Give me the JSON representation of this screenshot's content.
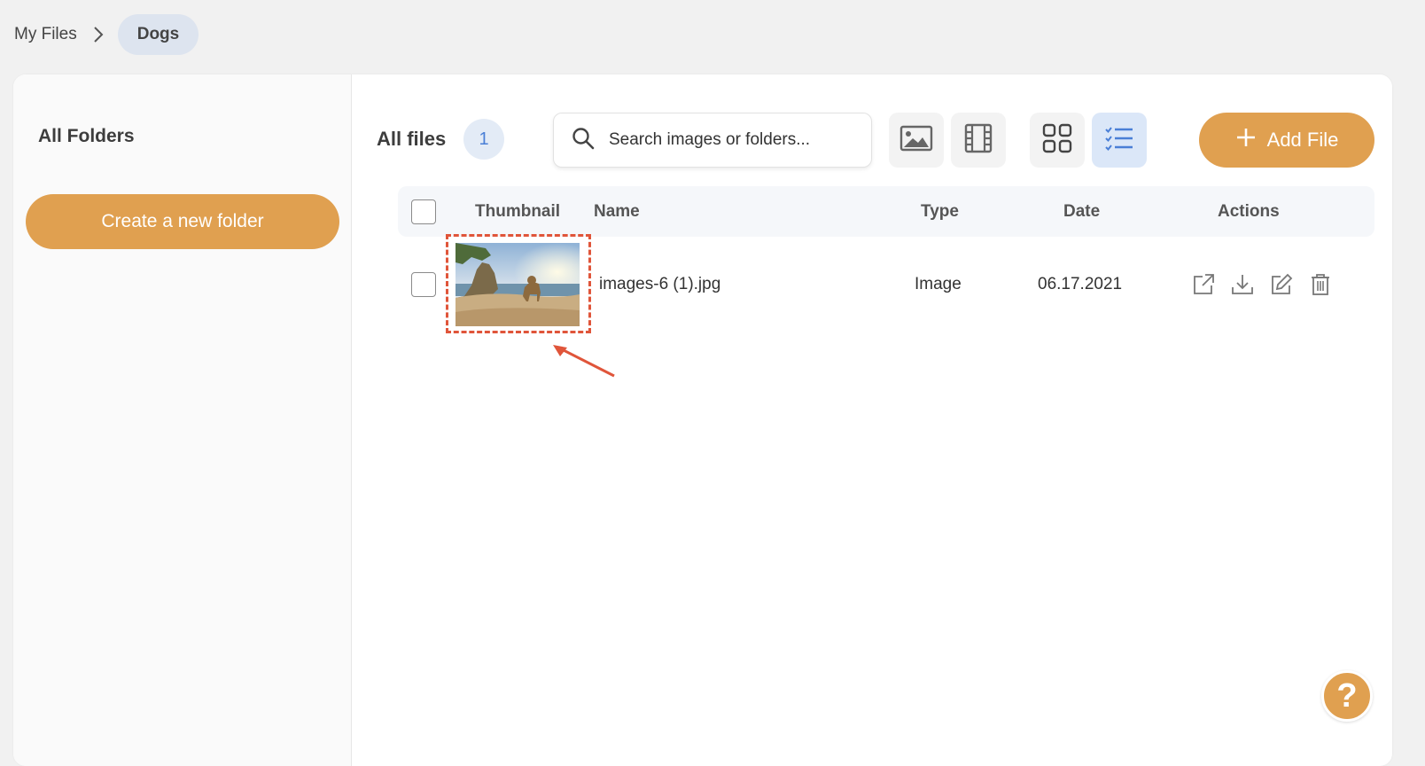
{
  "breadcrumb": {
    "root": "My Files",
    "current": "Dogs"
  },
  "sidebar": {
    "title": "All Folders",
    "new_folder_label": "Create a new folder"
  },
  "files": {
    "title": "All files",
    "count": "1"
  },
  "search": {
    "placeholder": "Search images or folders..."
  },
  "toolbar": {
    "filters": [
      "image-filter-icon",
      "video-filter-icon"
    ],
    "views": [
      "grid-view-icon",
      "list-view-icon"
    ],
    "active_view": "list",
    "add_file_label": "Add File"
  },
  "table": {
    "headers": {
      "thumbnail": "Thumbnail",
      "name": "Name",
      "type": "Type",
      "date": "Date",
      "actions": "Actions"
    },
    "rows": [
      {
        "name": "images-6 (1).jpg",
        "type": "Image",
        "date": "06.17.2021",
        "actions": [
          "share-icon",
          "download-icon",
          "edit-icon",
          "delete-icon"
        ]
      }
    ]
  },
  "help_label": "?",
  "colors": {
    "accent": "#e0a050",
    "highlight": "#e0553a",
    "active_view": "#dbe7f8",
    "count_badge": "#4a7fd6"
  }
}
